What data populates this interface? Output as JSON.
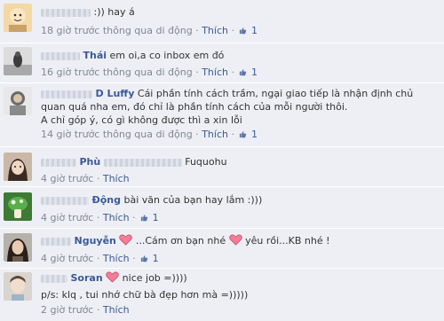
{
  "comments": [
    {
      "name": "",
      "text": ":)) hay á",
      "time": "18 giờ trước thông qua di động",
      "like_label": "Thích",
      "likes": "1"
    },
    {
      "name": "Thái",
      "text": "em oi,a co inbox em đó",
      "time": "16 giờ trước thông qua di động",
      "like_label": "Thích",
      "likes": "1"
    },
    {
      "name": "D Luffy",
      "text": "Cái phần tính cách trầm, ngại giao tiếp là nhận định chủ quan quá nha em, đó chỉ là phần tính cách của mỗi người thôi.",
      "text2": "A chỉ góp ý, có gì không được thì a xin lỗi",
      "time": "14 giờ trước thông qua di động",
      "like_label": "Thích",
      "likes": "1"
    },
    {
      "name": "Phù",
      "text": "Fuquohu",
      "time": "4 giờ trước",
      "like_label": "Thích"
    },
    {
      "name": "Động",
      "text": "bài văn của bạn hay lắm :)))",
      "time": "4 giờ trước",
      "like_label": "Thích",
      "likes": "1"
    },
    {
      "name": "Nguyễn",
      "text_a": "...Cám ơn bạn nhé",
      "text_b": "yêu rồi...KB nhé !",
      "time": "4 giờ trước",
      "like_label": "Thích",
      "likes": "1"
    },
    {
      "name": "Soran",
      "text": "nice job =))))",
      "text2": "p/s: klq , tui nhớ chữ bà đẹp hơn mà =)))))",
      "time": "2 giờ trước",
      "like_label": "Thích"
    }
  ],
  "separator": "·",
  "colors": {
    "link": "#3b5998",
    "meta": "#808890",
    "heart": "#e0607e",
    "bg": "#edeff4"
  },
  "icons": {
    "like": "thumbs-up-icon",
    "heart": "heart-emoticon-icon"
  }
}
